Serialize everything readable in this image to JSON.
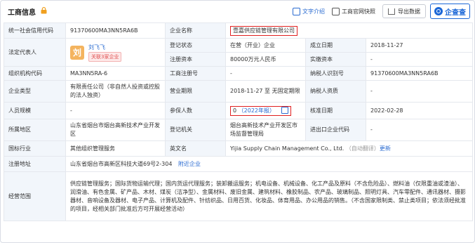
{
  "header": {
    "title": "工商信息",
    "text_intro": "文字介绍",
    "official_site": "工商官网快照",
    "export": "导出数据",
    "brand": "企查查"
  },
  "rows": {
    "credit_code_label": "统一社会信用代码",
    "credit_code": "91370600MA3NN5RA6B",
    "company_name_label": "企业名称",
    "company_name": "壹嘉供应链管理有限公司",
    "legal_rep_label": "法定代表人",
    "legal_rep_avatar": "刘",
    "legal_rep_name": "刘飞飞",
    "legal_rep_related": "关联3家企业",
    "reg_status_label": "登记状态",
    "reg_status": "在营（开业）企业",
    "est_date_label": "成立日期",
    "est_date": "2018-11-27",
    "reg_capital_label": "注册资本",
    "reg_capital": "80000万元人民币",
    "paid_capital_label": "实缴资本",
    "paid_capital": "-",
    "org_code_label": "组织机构代码",
    "org_code": "MA3NN5RA-6",
    "biz_reg_no_label": "工商注册号",
    "biz_reg_no": "-",
    "taxpayer_id_label": "纳税人识别号",
    "taxpayer_id": "91370600MA3NN5RA6B",
    "ent_type_label": "企业类型",
    "ent_type": "有限责任公司（非自然人投资或控股的法人独资）",
    "biz_term_label": "营业期限",
    "biz_term": "2018-11-27 至 无固定期限",
    "taxpayer_qual_label": "纳税人资质",
    "taxpayer_qual": "-",
    "staff_size_label": "人员规模",
    "staff_size": "-",
    "insured_label": "参保人数",
    "insured_count": "0",
    "insured_year": "（2022年报）",
    "approval_date_label": "核准日期",
    "approval_date": "2022-02-28",
    "region_label": "所属地区",
    "region": "山东省烟台市烟台高新技术产业开发区",
    "reg_authority_label": "登记机关",
    "reg_authority": "烟台高新技术产业开发区市场监督管理局",
    "import_export_label": "进出口企业代码",
    "import_export": "-",
    "industry_label": "国标行业",
    "industry": "其他组织管理服务",
    "english_name_label": "英文名",
    "english_name": "Yijia Supply Chain Management Co., Ltd.",
    "english_note": "（自动翻译）",
    "english_update": "更新",
    "address_label": "注册地址",
    "address": "山东省烟台市高新区科技大道69号2-304",
    "address_nearby": "附近企业",
    "scope_label": "经营范围",
    "scope": "供应链管理服务；国际货物运输代理；国内货运代理服务；装卸搬运服务；机电设备、机械设备、化工产品及原料（不含危险品）、燃料油（仅限重油或渣油）、润滑油、有色金属、矿产品、木材、煤炭（洁净型）、金属材料、废旧金属、建筑材料、橡胶制品、农产品、玻璃制品、照明灯具、汽车零配件、通讯器材、摄影器材、音响设备及器材、电子产品、计算机及配件、针纺织品、日用百货、化妆品、体育用品、办公用品的销售。（不含国家限制类、禁止类项目；依法须经批准的项目，经相关部门批准后方可开展经营活动）"
  }
}
